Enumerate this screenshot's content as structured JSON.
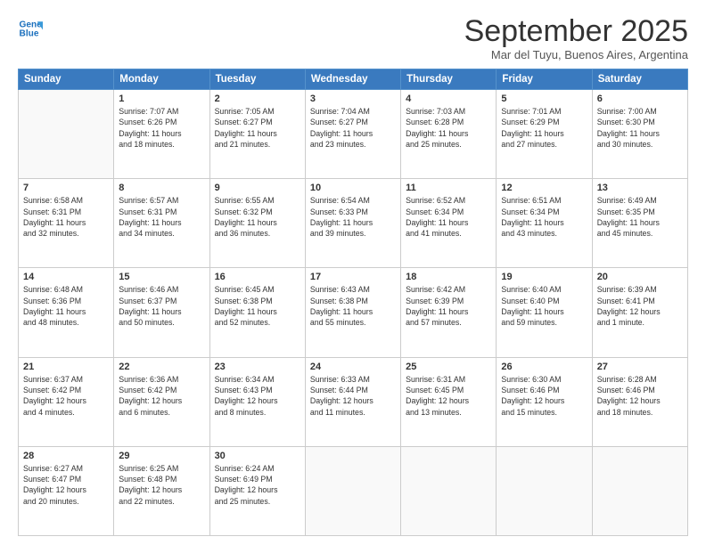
{
  "logo": {
    "line1": "General",
    "line2": "Blue"
  },
  "title": "September 2025",
  "location": "Mar del Tuyu, Buenos Aires, Argentina",
  "weekdays": [
    "Sunday",
    "Monday",
    "Tuesday",
    "Wednesday",
    "Thursday",
    "Friday",
    "Saturday"
  ],
  "weeks": [
    [
      {
        "day": "",
        "info": ""
      },
      {
        "day": "1",
        "info": "Sunrise: 7:07 AM\nSunset: 6:26 PM\nDaylight: 11 hours\nand 18 minutes."
      },
      {
        "day": "2",
        "info": "Sunrise: 7:05 AM\nSunset: 6:27 PM\nDaylight: 11 hours\nand 21 minutes."
      },
      {
        "day": "3",
        "info": "Sunrise: 7:04 AM\nSunset: 6:27 PM\nDaylight: 11 hours\nand 23 minutes."
      },
      {
        "day": "4",
        "info": "Sunrise: 7:03 AM\nSunset: 6:28 PM\nDaylight: 11 hours\nand 25 minutes."
      },
      {
        "day": "5",
        "info": "Sunrise: 7:01 AM\nSunset: 6:29 PM\nDaylight: 11 hours\nand 27 minutes."
      },
      {
        "day": "6",
        "info": "Sunrise: 7:00 AM\nSunset: 6:30 PM\nDaylight: 11 hours\nand 30 minutes."
      }
    ],
    [
      {
        "day": "7",
        "info": "Sunrise: 6:58 AM\nSunset: 6:31 PM\nDaylight: 11 hours\nand 32 minutes."
      },
      {
        "day": "8",
        "info": "Sunrise: 6:57 AM\nSunset: 6:31 PM\nDaylight: 11 hours\nand 34 minutes."
      },
      {
        "day": "9",
        "info": "Sunrise: 6:55 AM\nSunset: 6:32 PM\nDaylight: 11 hours\nand 36 minutes."
      },
      {
        "day": "10",
        "info": "Sunrise: 6:54 AM\nSunset: 6:33 PM\nDaylight: 11 hours\nand 39 minutes."
      },
      {
        "day": "11",
        "info": "Sunrise: 6:52 AM\nSunset: 6:34 PM\nDaylight: 11 hours\nand 41 minutes."
      },
      {
        "day": "12",
        "info": "Sunrise: 6:51 AM\nSunset: 6:34 PM\nDaylight: 11 hours\nand 43 minutes."
      },
      {
        "day": "13",
        "info": "Sunrise: 6:49 AM\nSunset: 6:35 PM\nDaylight: 11 hours\nand 45 minutes."
      }
    ],
    [
      {
        "day": "14",
        "info": "Sunrise: 6:48 AM\nSunset: 6:36 PM\nDaylight: 11 hours\nand 48 minutes."
      },
      {
        "day": "15",
        "info": "Sunrise: 6:46 AM\nSunset: 6:37 PM\nDaylight: 11 hours\nand 50 minutes."
      },
      {
        "day": "16",
        "info": "Sunrise: 6:45 AM\nSunset: 6:38 PM\nDaylight: 11 hours\nand 52 minutes."
      },
      {
        "day": "17",
        "info": "Sunrise: 6:43 AM\nSunset: 6:38 PM\nDaylight: 11 hours\nand 55 minutes."
      },
      {
        "day": "18",
        "info": "Sunrise: 6:42 AM\nSunset: 6:39 PM\nDaylight: 11 hours\nand 57 minutes."
      },
      {
        "day": "19",
        "info": "Sunrise: 6:40 AM\nSunset: 6:40 PM\nDaylight: 11 hours\nand 59 minutes."
      },
      {
        "day": "20",
        "info": "Sunrise: 6:39 AM\nSunset: 6:41 PM\nDaylight: 12 hours\nand 1 minute."
      }
    ],
    [
      {
        "day": "21",
        "info": "Sunrise: 6:37 AM\nSunset: 6:42 PM\nDaylight: 12 hours\nand 4 minutes."
      },
      {
        "day": "22",
        "info": "Sunrise: 6:36 AM\nSunset: 6:42 PM\nDaylight: 12 hours\nand 6 minutes."
      },
      {
        "day": "23",
        "info": "Sunrise: 6:34 AM\nSunset: 6:43 PM\nDaylight: 12 hours\nand 8 minutes."
      },
      {
        "day": "24",
        "info": "Sunrise: 6:33 AM\nSunset: 6:44 PM\nDaylight: 12 hours\nand 11 minutes."
      },
      {
        "day": "25",
        "info": "Sunrise: 6:31 AM\nSunset: 6:45 PM\nDaylight: 12 hours\nand 13 minutes."
      },
      {
        "day": "26",
        "info": "Sunrise: 6:30 AM\nSunset: 6:46 PM\nDaylight: 12 hours\nand 15 minutes."
      },
      {
        "day": "27",
        "info": "Sunrise: 6:28 AM\nSunset: 6:46 PM\nDaylight: 12 hours\nand 18 minutes."
      }
    ],
    [
      {
        "day": "28",
        "info": "Sunrise: 6:27 AM\nSunset: 6:47 PM\nDaylight: 12 hours\nand 20 minutes."
      },
      {
        "day": "29",
        "info": "Sunrise: 6:25 AM\nSunset: 6:48 PM\nDaylight: 12 hours\nand 22 minutes."
      },
      {
        "day": "30",
        "info": "Sunrise: 6:24 AM\nSunset: 6:49 PM\nDaylight: 12 hours\nand 25 minutes."
      },
      {
        "day": "",
        "info": ""
      },
      {
        "day": "",
        "info": ""
      },
      {
        "day": "",
        "info": ""
      },
      {
        "day": "",
        "info": ""
      }
    ]
  ]
}
